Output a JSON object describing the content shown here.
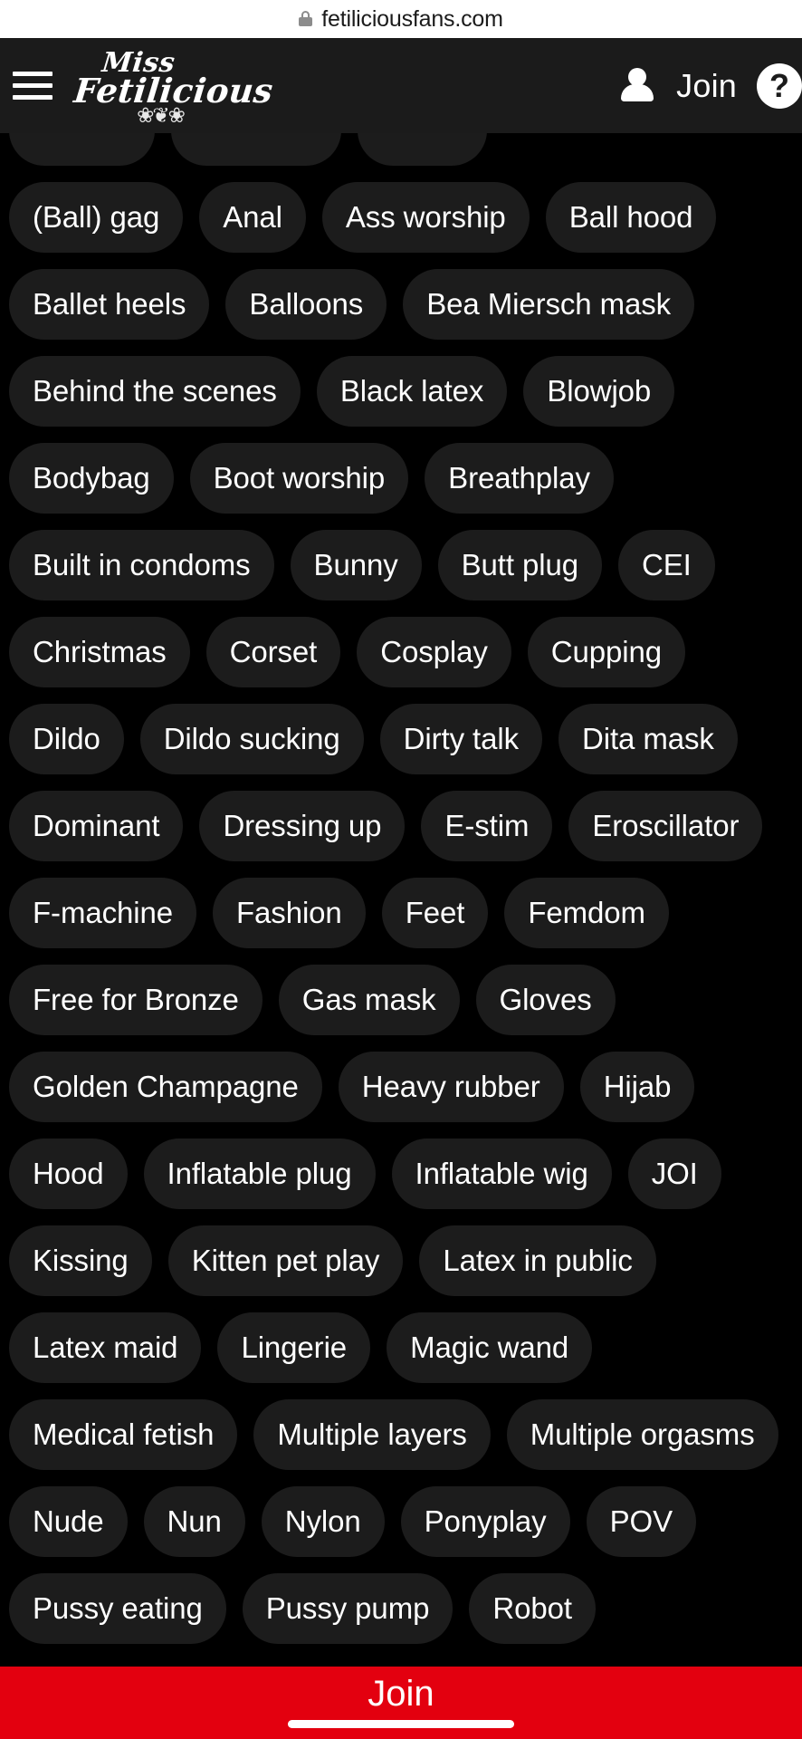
{
  "browser": {
    "url": "fetiliciousfans.com",
    "lock_icon": "lock-icon"
  },
  "header": {
    "menu_icon": "hamburger-menu-icon",
    "logo": {
      "line1": "Miss",
      "line2": "Fetilicious",
      "flourish": "❀❦❀"
    },
    "account_icon": "person-icon",
    "join_label": "Join",
    "help_label": "?"
  },
  "tags": {
    "rows": [
      {
        "clipped": true,
        "items": [
          "            ",
          "               ",
          "          "
        ]
      },
      {
        "clipped": false,
        "items": [
          "(Ball) gag",
          "Anal",
          "Ass worship",
          "Ball hood"
        ]
      },
      {
        "clipped": false,
        "items": [
          "Ballet heels",
          "Balloons",
          "Bea Miersch mask"
        ]
      },
      {
        "clipped": false,
        "items": [
          "Behind the scenes",
          "Black latex",
          "Blowjob"
        ]
      },
      {
        "clipped": false,
        "items": [
          "Bodybag",
          "Boot worship",
          "Breathplay"
        ]
      },
      {
        "clipped": false,
        "items": [
          "Built in condoms",
          "Bunny",
          "Butt plug",
          "CEI"
        ]
      },
      {
        "clipped": false,
        "items": [
          "Christmas",
          "Corset",
          "Cosplay",
          "Cupping"
        ]
      },
      {
        "clipped": false,
        "items": [
          "Dildo",
          "Dildo sucking",
          "Dirty talk",
          "Dita mask"
        ]
      },
      {
        "clipped": false,
        "items": [
          "Dominant",
          "Dressing up",
          "E-stim",
          "Eroscillator"
        ]
      },
      {
        "clipped": false,
        "items": [
          "F-machine",
          "Fashion",
          "Feet",
          "Femdom"
        ]
      },
      {
        "clipped": false,
        "items": [
          "Free for Bronze",
          "Gas mask",
          "Gloves"
        ]
      },
      {
        "clipped": false,
        "items": [
          "Golden Champagne",
          "Heavy rubber",
          "Hijab"
        ]
      },
      {
        "clipped": false,
        "items": [
          "Hood",
          "Inflatable plug",
          "Inflatable wig",
          "JOI"
        ]
      },
      {
        "clipped": false,
        "items": [
          "Kissing",
          "Kitten pet play",
          "Latex in public"
        ]
      },
      {
        "clipped": false,
        "items": [
          "Latex maid",
          "Lingerie",
          "Magic wand"
        ]
      },
      {
        "clipped": false,
        "items": [
          "Medical fetish",
          "Multiple layers",
          "Multiple orgasms"
        ]
      },
      {
        "clipped": false,
        "items": [
          "Nude",
          "Nun",
          "Nylon",
          "Ponyplay",
          "POV"
        ]
      },
      {
        "clipped": false,
        "items": [
          "Pussy eating",
          "Pussy pump",
          "Robot"
        ]
      }
    ]
  },
  "bottom_bar": {
    "join_label": "Join",
    "accent_color": "#e3000f",
    "home_indicator": "home-indicator"
  }
}
